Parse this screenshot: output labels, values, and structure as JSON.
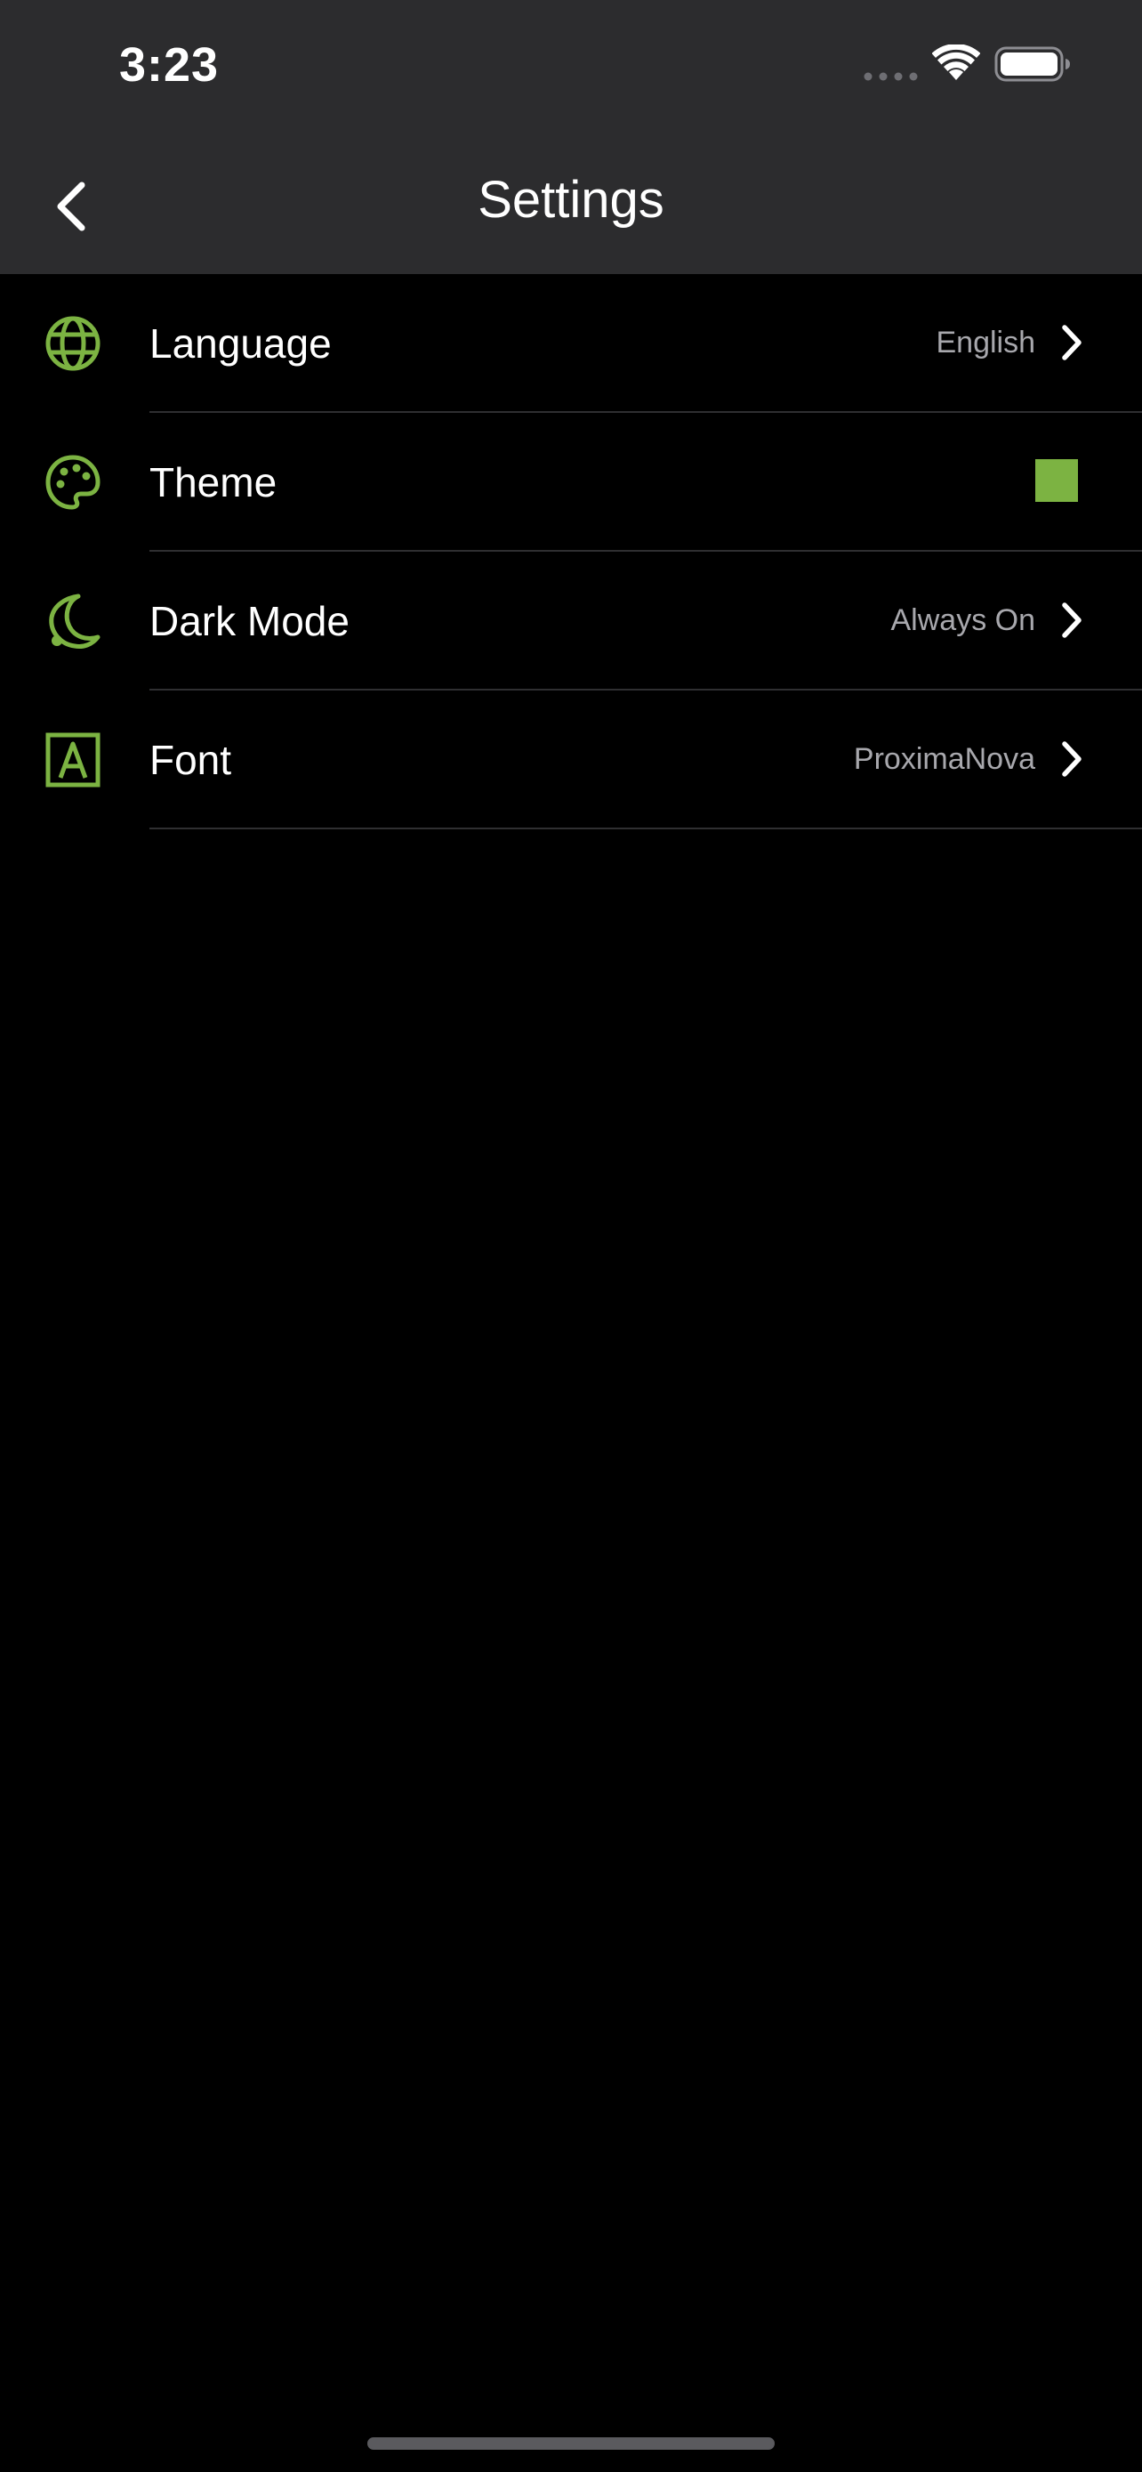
{
  "status_bar": {
    "time": "3:23"
  },
  "nav": {
    "title": "Settings",
    "back_icon": "chevron-left-icon"
  },
  "colors": {
    "accent": "#7cb342",
    "header_bg": "#2c2c2e",
    "background": "#000000",
    "secondary_text": "#a8a8ad",
    "theme_swatch": "#7cb342"
  },
  "settings": {
    "items": [
      {
        "label": "Language",
        "value": "English",
        "icon": "globe-icon"
      },
      {
        "label": "Theme",
        "value": "",
        "icon": "palette-icon"
      },
      {
        "label": "Dark Mode",
        "value": "Always On",
        "icon": "moon-icon"
      },
      {
        "label": "Font",
        "value": "ProximaNova",
        "icon": "font-icon"
      }
    ]
  }
}
